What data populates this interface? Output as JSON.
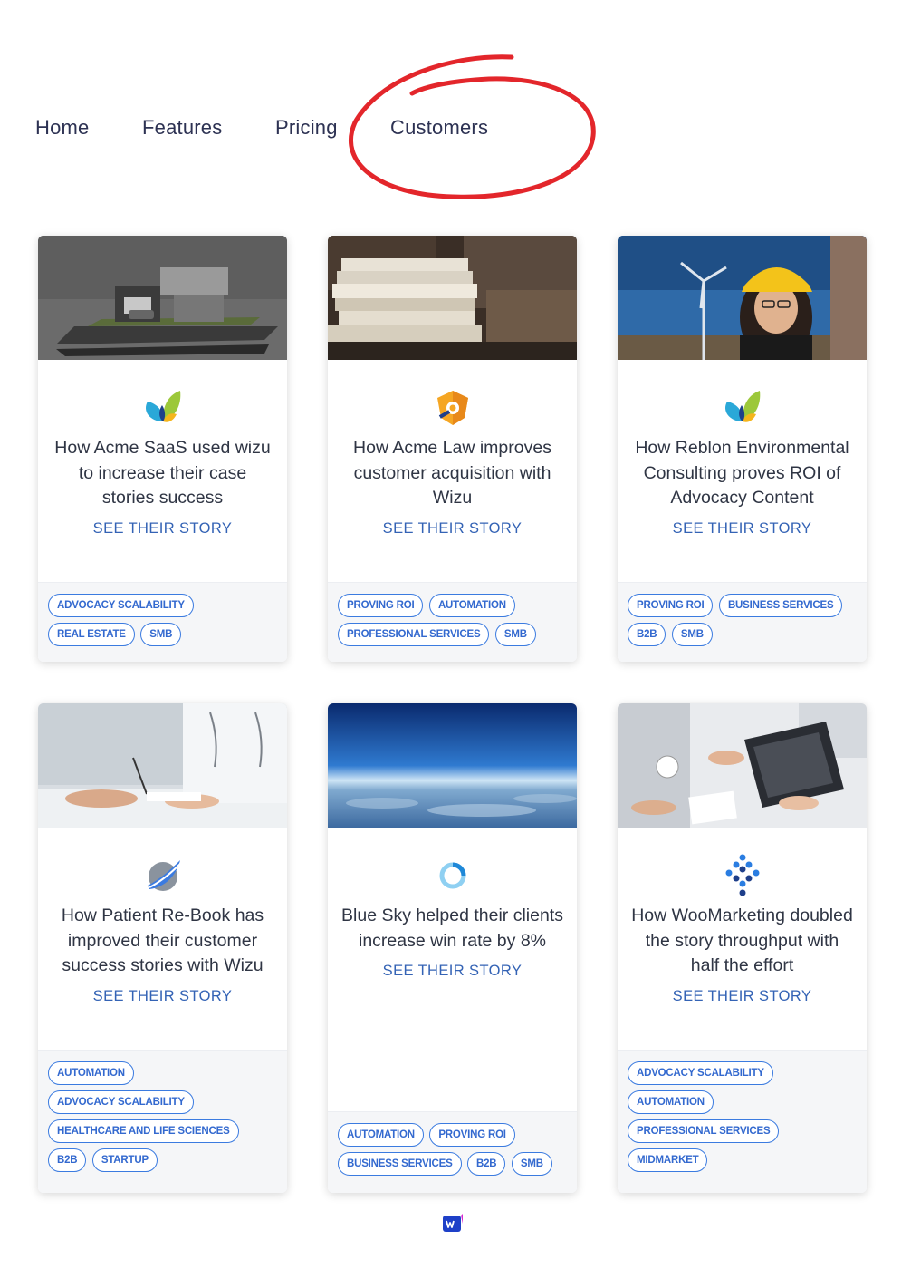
{
  "nav": {
    "items": [
      {
        "label": "Home"
      },
      {
        "label": "Features"
      },
      {
        "label": "Pricing"
      },
      {
        "label": "Customers"
      }
    ],
    "annotation_color": "#e3262b"
  },
  "cards": [
    {
      "image": "modern-house-model",
      "logo": "leaf-logo-icon",
      "title": "How Acme SaaS used wizu to increase their case stories success",
      "cta": "SEE THEIR STORY",
      "tags": [
        "ADVOCACY SCALABILITY",
        "REAL ESTATE",
        "SMB"
      ]
    },
    {
      "image": "stacked-books",
      "logo": "shield-logo-icon",
      "title": "How Acme Law improves customer acquisition with Wizu",
      "cta": "SEE THEIR STORY",
      "tags": [
        "PROVING ROI",
        "AUTOMATION",
        "PROFESSIONAL SERVICES",
        "SMB"
      ]
    },
    {
      "image": "engineer-wind-turbine",
      "logo": "leaf-logo-icon",
      "title": "How Reblon Environmental Consulting proves ROI of Advocacy Content",
      "cta": "SEE THEIR STORY",
      "tags": [
        "PROVING ROI",
        "BUSINESS SERVICES",
        "B2B",
        "SMB"
      ]
    },
    {
      "image": "doctor-consultation",
      "logo": "swoosh-logo-icon",
      "title": "How Patient Re-Book has improved their customer success stories with Wizu",
      "cta": "SEE THEIR STORY",
      "tags": [
        "AUTOMATION",
        "ADVOCACY SCALABILITY",
        "HEALTHCARE AND LIFE SCIENCES",
        "B2B",
        "STARTUP"
      ]
    },
    {
      "image": "sky-above-clouds",
      "logo": "ring-logo-icon",
      "title": "Blue Sky helped their clients increase win rate by 8%",
      "cta": "SEE THEIR STORY",
      "tags": [
        "AUTOMATION",
        "PROVING ROI",
        "BUSINESS SERVICES",
        "B2B",
        "SMB"
      ]
    },
    {
      "image": "team-laptop-meeting",
      "logo": "dots-logo-icon",
      "title": "How WooMarketing doubled the story throughput with half the effort",
      "cta": "SEE THEIR STORY",
      "tags": [
        "ADVOCACY SCALABILITY",
        "AUTOMATION",
        "PROFESSIONAL SERVICES",
        "MIDMARKET"
      ]
    }
  ],
  "colors": {
    "accent": "#3463b5",
    "tag_border": "#3b7be0",
    "nav_text": "#2d3253"
  },
  "footer": {
    "logo": "wizu-logo-icon"
  }
}
